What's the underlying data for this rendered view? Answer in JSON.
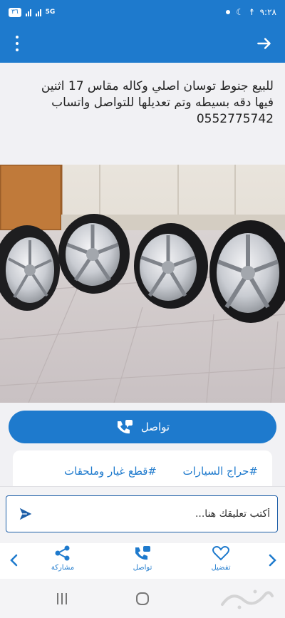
{
  "status_bar": {
    "time": "٩:٢٨",
    "battery": "٣٦",
    "network": "5G"
  },
  "app_bar": {
    "back_icon": "arrow-right-icon",
    "menu_icon": "more-vertical-icon"
  },
  "post": {
    "lines": [
      "للبيع جنوط توسان اصلي وكاله مقاس 17 اثنين",
      "فيها دقه بسيطه وتم تعديلها للتواصل واتساب",
      "0552775742"
    ]
  },
  "contact_button": {
    "label": "تواصل",
    "icon": "phone-chat-icon"
  },
  "tags": [
    {
      "label": "#حراج السيارات"
    },
    {
      "label": "#قطع غيار وملحقات"
    }
  ],
  "comment": {
    "placeholder": "أكتب تعليقك هنا...",
    "send_icon": "send-icon"
  },
  "actions": {
    "favorite": "تفضيل",
    "contact": "تواصل",
    "share": "مشاركة"
  },
  "colors": {
    "primary": "#1e7acd",
    "dark_border": "#1e5fa8",
    "background": "#f1f1f4"
  }
}
